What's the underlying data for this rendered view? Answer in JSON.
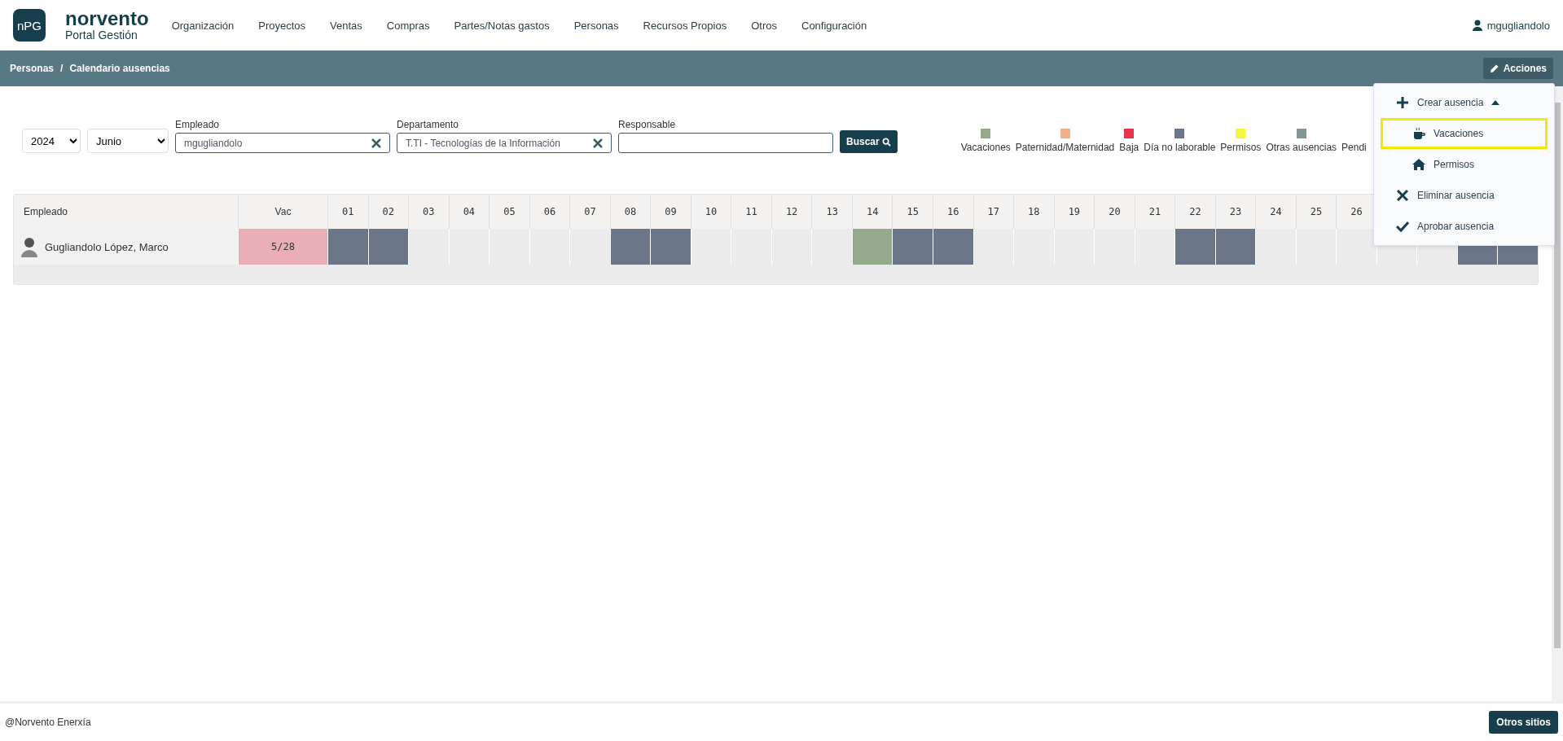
{
  "header": {
    "logo_badge": "nPG",
    "brand": "norvento",
    "subtitle": "Portal Gestión",
    "nav": [
      "Organización",
      "Proyectos",
      "Ventas",
      "Compras",
      "Partes/Notas gastos",
      "Personas",
      "Recursos Propios",
      "Otros",
      "Configuración"
    ],
    "user": "mgugliandolo"
  },
  "breadcrumb": {
    "items": [
      "Personas",
      "Calendario ausencias"
    ],
    "separator": "/",
    "actions_button": "Acciones"
  },
  "filters": {
    "year": "2024",
    "month": "Junio",
    "fields": [
      {
        "label": "Empleado",
        "value": "mgugliandolo",
        "clearable": true
      },
      {
        "label": "Departamento",
        "value": "T.TI - Tecnologías de la Información",
        "clearable": true
      },
      {
        "label": "Responsable",
        "clearable": false
      }
    ],
    "search_button": "Buscar"
  },
  "legend": [
    {
      "label": "Vacaciones",
      "color": "#93a98a"
    },
    {
      "label": "Paternidad/Maternidad",
      "color": "#f2b08a"
    },
    {
      "label": "Baja",
      "color": "#e8344a"
    },
    {
      "label": "Día no laborable",
      "color": "#6b7789"
    },
    {
      "label": "Permisos",
      "color": "#f5f542"
    },
    {
      "label": "Otras ausencias",
      "color": "#7f9596"
    },
    {
      "label": "Pendi"
    }
  ],
  "table": {
    "columns": [
      "Empleado",
      "Vac"
    ],
    "days": [
      {
        "label": "01",
        "kind": "off"
      },
      {
        "label": "02",
        "kind": "off"
      },
      {
        "label": "03",
        "kind": "work"
      },
      {
        "label": "04",
        "kind": "work"
      },
      {
        "label": "05",
        "kind": "work"
      },
      {
        "label": "06",
        "kind": "work"
      },
      {
        "label": "07",
        "kind": "work"
      },
      {
        "label": "08",
        "kind": "off"
      },
      {
        "label": "09",
        "kind": "off"
      },
      {
        "label": "10",
        "kind": "work"
      },
      {
        "label": "11",
        "kind": "work"
      },
      {
        "label": "12",
        "kind": "work"
      },
      {
        "label": "13",
        "kind": "work"
      },
      {
        "label": "14",
        "kind": "vacation"
      },
      {
        "label": "15",
        "kind": "off"
      },
      {
        "label": "16",
        "kind": "off"
      },
      {
        "label": "17",
        "kind": "work"
      },
      {
        "label": "18",
        "kind": "work"
      },
      {
        "label": "19",
        "kind": "work"
      },
      {
        "label": "20",
        "kind": "work"
      },
      {
        "label": "21",
        "kind": "work"
      },
      {
        "label": "22",
        "kind": "off"
      },
      {
        "label": "23",
        "kind": "off"
      },
      {
        "label": "24",
        "kind": "work"
      },
      {
        "label": "25",
        "kind": "work"
      },
      {
        "label": "26",
        "kind": "work"
      },
      {
        "kind": "work"
      },
      {
        "kind": "work"
      },
      {
        "kind": "off"
      },
      {
        "kind": "off"
      }
    ],
    "rows": [
      {
        "name": "Gugliandolo López, Marco",
        "vac": "5/28"
      }
    ]
  },
  "menu": [
    {
      "label": "Crear ausencia",
      "expanded": true,
      "children": [
        {
          "label": "Vacaciones",
          "selected": true
        },
        {
          "label": "Permisos",
          "selected": false
        }
      ]
    },
    {
      "label": "Eliminar ausencia"
    },
    {
      "label": "Aprobar ausencia"
    }
  ],
  "footer": {
    "copyright": "@Norvento Enerxía",
    "button": "Otros sitios"
  }
}
